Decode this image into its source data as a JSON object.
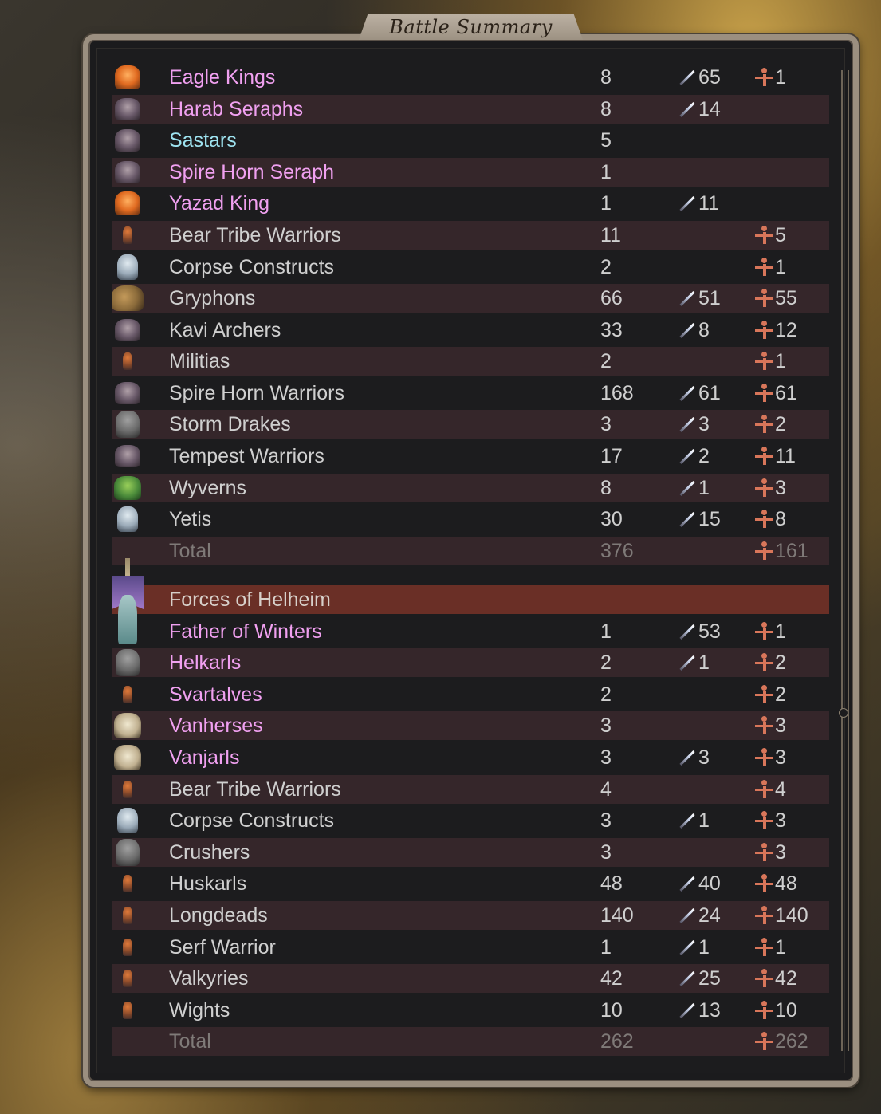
{
  "window": {
    "title": "Battle Summary"
  },
  "sections": [
    {
      "rows": [
        {
          "icon": "eagle-king-portrait",
          "name": "Eagle Kings",
          "name_color": "pink",
          "count": "8",
          "kills": "65",
          "losses": "1"
        },
        {
          "icon": "harab-seraph-portrait",
          "name": "Harab Seraphs",
          "name_color": "pink",
          "count": "8",
          "kills": "14",
          "losses": ""
        },
        {
          "icon": "sastar-portrait",
          "name": "Sastars",
          "name_color": "cyan",
          "count": "5",
          "kills": "",
          "losses": ""
        },
        {
          "icon": "spire-horn-seraph-portrait",
          "name": "Spire Horn Seraph",
          "name_color": "pink",
          "count": "1",
          "kills": "",
          "losses": ""
        },
        {
          "icon": "yazad-king-portrait",
          "name": "Yazad King",
          "name_color": "pink",
          "count": "1",
          "kills": "11",
          "losses": ""
        },
        {
          "icon": "bear-tribe-warrior-portrait",
          "name": "Bear Tribe Warriors",
          "name_color": "grey",
          "count": "11",
          "kills": "",
          "losses": "5"
        },
        {
          "icon": "corpse-construct-portrait",
          "name": "Corpse Constructs",
          "name_color": "grey",
          "count": "2",
          "kills": "",
          "losses": "1"
        },
        {
          "icon": "gryphon-portrait",
          "name": "Gryphons",
          "name_color": "grey",
          "count": "66",
          "kills": "51",
          "losses": "55"
        },
        {
          "icon": "kavi-archer-portrait",
          "name": "Kavi Archers",
          "name_color": "grey",
          "count": "33",
          "kills": "8",
          "losses": "12"
        },
        {
          "icon": "militia-portrait",
          "name": "Militias",
          "name_color": "grey",
          "count": "2",
          "kills": "",
          "losses": "1"
        },
        {
          "icon": "spire-horn-warrior-portrait",
          "name": "Spire Horn Warriors",
          "name_color": "grey",
          "count": "168",
          "kills": "61",
          "losses": "61"
        },
        {
          "icon": "storm-drake-portrait",
          "name": "Storm Drakes",
          "name_color": "grey",
          "count": "3",
          "kills": "3",
          "losses": "2"
        },
        {
          "icon": "tempest-warrior-portrait",
          "name": "Tempest Warriors",
          "name_color": "grey",
          "count": "17",
          "kills": "2",
          "losses": "11"
        },
        {
          "icon": "wyvern-portrait",
          "name": "Wyverns",
          "name_color": "grey",
          "count": "8",
          "kills": "1",
          "losses": "3"
        },
        {
          "icon": "yeti-portrait",
          "name": "Yetis",
          "name_color": "grey",
          "count": "30",
          "kills": "15",
          "losses": "8"
        }
      ],
      "total": {
        "label": "Total",
        "count": "376",
        "losses": "161"
      }
    },
    {
      "header": "Forces of Helheim",
      "rows": [
        {
          "icon": "father-of-winters-portrait",
          "name": "Father of Winters",
          "name_color": "pink",
          "count": "1",
          "kills": "53",
          "losses": "1"
        },
        {
          "icon": "helkarl-portrait",
          "name": "Helkarls",
          "name_color": "pink",
          "count": "2",
          "kills": "1",
          "losses": "2"
        },
        {
          "icon": "svartalf-portrait",
          "name": "Svartalves",
          "name_color": "pink",
          "count": "2",
          "kills": "",
          "losses": "2"
        },
        {
          "icon": "vanherse-portrait",
          "name": "Vanherses",
          "name_color": "pink",
          "count": "3",
          "kills": "",
          "losses": "3"
        },
        {
          "icon": "vanjarl-portrait",
          "name": "Vanjarls",
          "name_color": "pink",
          "count": "3",
          "kills": "3",
          "losses": "3"
        },
        {
          "icon": "bear-tribe-warrior-portrait",
          "name": "Bear Tribe Warriors",
          "name_color": "grey",
          "count": "4",
          "kills": "",
          "losses": "4"
        },
        {
          "icon": "corpse-construct-portrait",
          "name": "Corpse Constructs",
          "name_color": "grey",
          "count": "3",
          "kills": "1",
          "losses": "3"
        },
        {
          "icon": "crusher-portrait",
          "name": "Crushers",
          "name_color": "grey",
          "count": "3",
          "kills": "",
          "losses": "3"
        },
        {
          "icon": "huskarl-portrait",
          "name": "Huskarls",
          "name_color": "grey",
          "count": "48",
          "kills": "40",
          "losses": "48"
        },
        {
          "icon": "longdead-portrait",
          "name": "Longdeads",
          "name_color": "grey",
          "count": "140",
          "kills": "24",
          "losses": "140"
        },
        {
          "icon": "serf-warrior-portrait",
          "name": "Serf Warrior",
          "name_color": "grey",
          "count": "1",
          "kills": "1",
          "losses": "1"
        },
        {
          "icon": "valkyrie-portrait",
          "name": "Valkyries",
          "name_color": "grey",
          "count": "42",
          "kills": "25",
          "losses": "42"
        },
        {
          "icon": "wight-portrait",
          "name": "Wights",
          "name_color": "grey",
          "count": "10",
          "kills": "13",
          "losses": "10"
        }
      ],
      "total": {
        "label": "Total",
        "count": "262",
        "losses": "262"
      }
    }
  ],
  "colors": {
    "pink": "#f0a0f0",
    "cyan": "#9ee3f0",
    "grey": "#cfcfcf",
    "total": "#7f7a78",
    "row_alt": "#35262a",
    "header_row": "#6a2f26"
  }
}
